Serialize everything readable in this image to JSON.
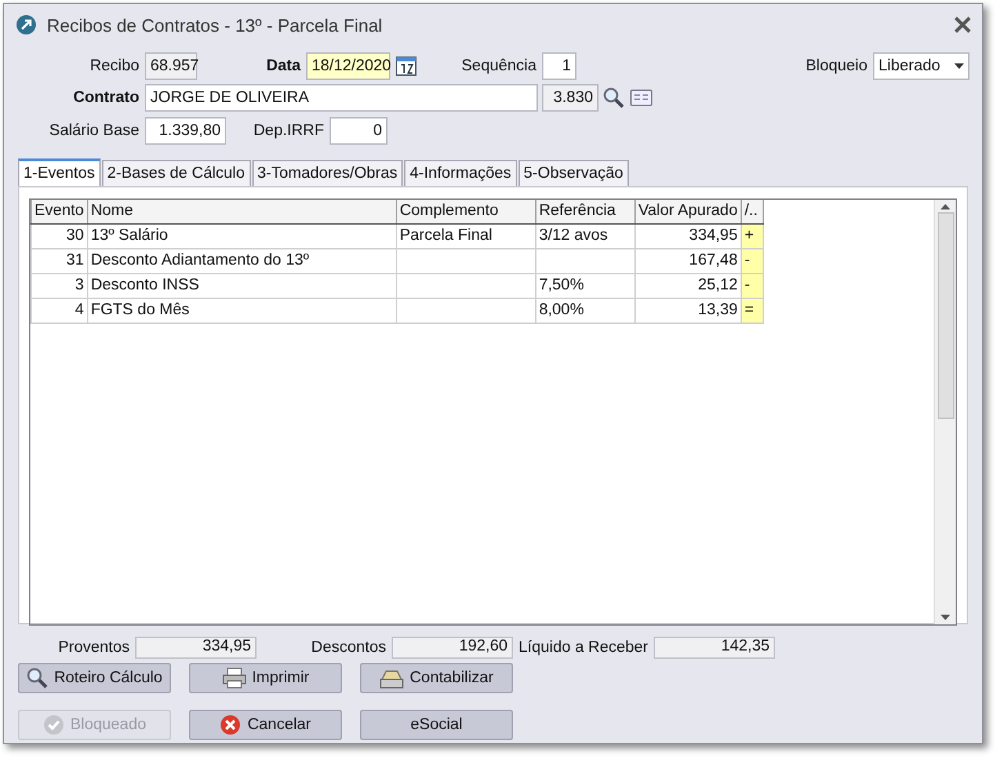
{
  "window": {
    "title": "Recibos de Contratos - 13º - Parcela Final"
  },
  "form": {
    "recibo_label": "Recibo",
    "recibo": "68.957",
    "data_label": "Data",
    "data": "18/12/2020",
    "sequencia_label": "Sequência",
    "sequencia": "1",
    "bloqueio_label": "Bloqueio",
    "bloqueio": "Liberado",
    "contrato_label": "Contrato",
    "contrato": "JORGE DE OLIVEIRA",
    "contrato_codigo": "3.830",
    "salario_label": "Salário Base",
    "salario": "1.339,80",
    "dep_label": "Dep.IRRF",
    "dep": "0"
  },
  "tabs": [
    {
      "label": "1-Eventos",
      "selected": true
    },
    {
      "label": "2-Bases de Cálculo",
      "selected": false
    },
    {
      "label": "3-Tomadores/Obras",
      "selected": false
    },
    {
      "label": "4-Informações",
      "selected": false
    },
    {
      "label": "5-Observação",
      "selected": false
    }
  ],
  "table": {
    "columns": [
      "Evento",
      "Nome",
      "Complemento",
      "Referência",
      "Valor Apurado",
      "/.."
    ],
    "rows": [
      {
        "evento": "30",
        "nome": "13º Salário",
        "complemento": "Parcela Final",
        "referencia": "3/12 avos",
        "valor": "334,95",
        "sinal": "+"
      },
      {
        "evento": "31",
        "nome": "Desconto Adiantamento do 13º",
        "complemento": "",
        "referencia": "",
        "valor": "167,48",
        "sinal": "-"
      },
      {
        "evento": "3",
        "nome": "Desconto INSS",
        "complemento": "",
        "referencia": "7,50%",
        "valor": "25,12",
        "sinal": "-"
      },
      {
        "evento": "4",
        "nome": "FGTS do Mês",
        "complemento": "",
        "referencia": "8,00%",
        "valor": "13,39",
        "sinal": "="
      }
    ]
  },
  "totals": [
    {
      "label": "Proventos",
      "value": "334,95"
    },
    {
      "label": "Descontos",
      "value": "192,60"
    },
    {
      "label": "Líquido a Receber",
      "value": "142,35"
    }
  ],
  "actions": [
    {
      "label": "Roteiro Cálculo",
      "kind": "search"
    },
    {
      "label": "Imprimir",
      "kind": "print"
    },
    {
      "label": "Contabilizar",
      "kind": "register"
    }
  ],
  "buttons": [
    {
      "label": "Bloqueado",
      "kind": "check",
      "disabled": true
    },
    {
      "label": "Cancelar",
      "kind": "cancel",
      "disabled": false
    },
    {
      "label": "eSocial",
      "kind": "plain",
      "disabled": false
    }
  ]
}
